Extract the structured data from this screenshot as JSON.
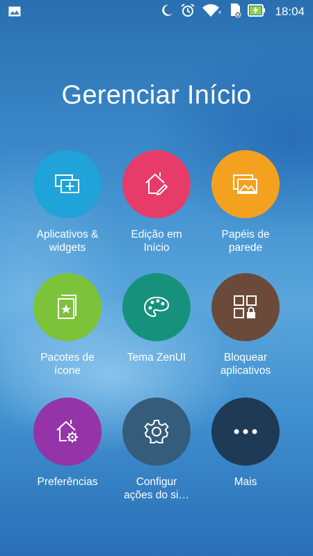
{
  "status_bar": {
    "time": "18:04",
    "icons": [
      "gallery-icon",
      "moon-icon",
      "alarm-icon",
      "wifi-icon",
      "sd-card-icon",
      "battery-charging-icon"
    ]
  },
  "page": {
    "title": "Gerenciar Início"
  },
  "tiles": [
    {
      "label": "Aplicativos &\nwidgets",
      "color": "#1fa3d8",
      "icon": "apps-widgets-icon"
    },
    {
      "label": "Edição em\nInício",
      "color": "#e73c6a",
      "icon": "home-edit-icon"
    },
    {
      "label": "Papéis de\nparede",
      "color": "#f4a11f",
      "icon": "wallpaper-icon"
    },
    {
      "label": "Pacotes de\nícone",
      "color": "#7cc33a",
      "icon": "icon-pack-icon"
    },
    {
      "label": "Tema ZenUI",
      "color": "#16927c",
      "icon": "palette-icon"
    },
    {
      "label": "Bloquear\naplicativos",
      "color": "#6b4a3a",
      "icon": "app-lock-icon"
    },
    {
      "label": "Preferências",
      "color": "#9434a8",
      "icon": "home-settings-icon"
    },
    {
      "label": "Configur\nações do si…",
      "color": "#365c7c",
      "icon": "gear-icon"
    },
    {
      "label": "Mais",
      "color": "#1e3a55",
      "icon": "more-icon"
    }
  ]
}
